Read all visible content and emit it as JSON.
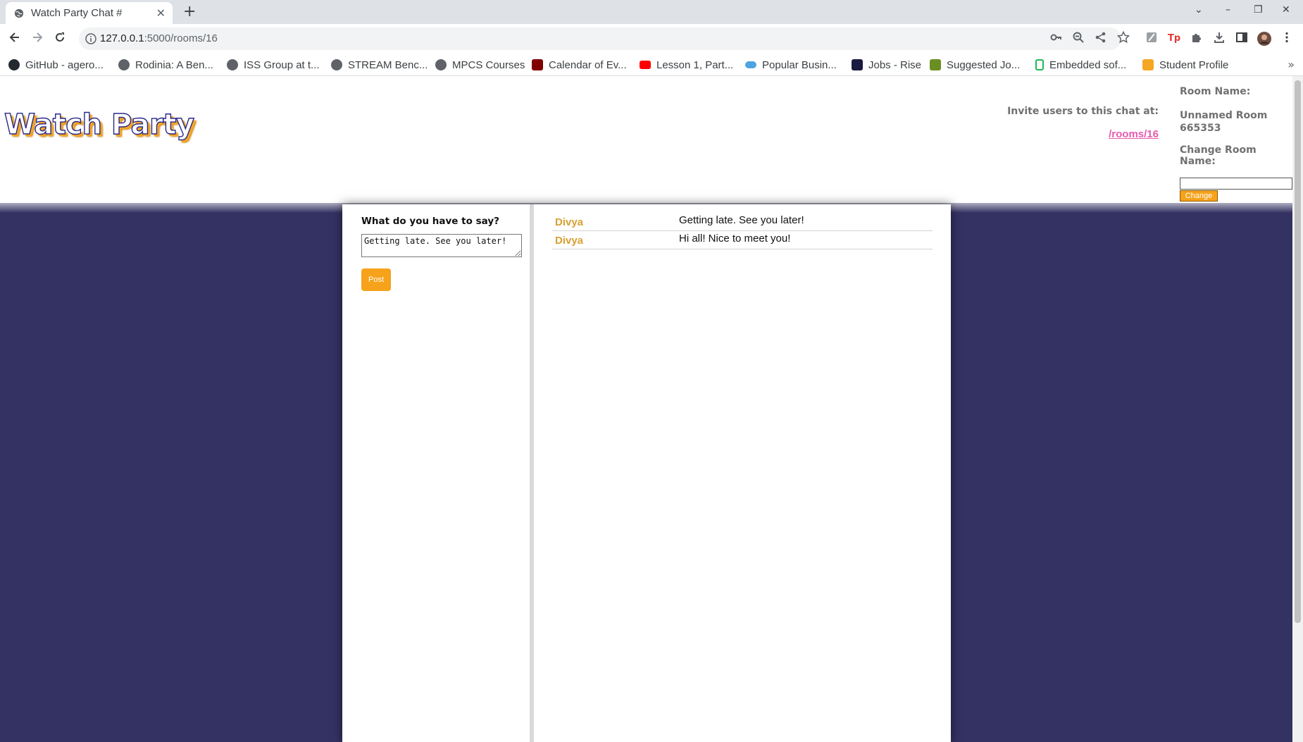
{
  "browser": {
    "tab_title": "Watch Party Chat #",
    "tab_close": "✕",
    "new_tab": "+",
    "url_host": "127.0.0.1",
    "url_rest": ":5000/rooms/16",
    "win_min": "–",
    "win_max": "❐",
    "win_close": "✕",
    "tab_list": "⌄"
  },
  "bookmarks": [
    {
      "label": "GitHub - agero...",
      "color": "#24292f"
    },
    {
      "label": "Rodinia: A Ben...",
      "color": "#5f6368"
    },
    {
      "label": "ISS Group at t...",
      "color": "#5f6368"
    },
    {
      "label": "STREAM Benc...",
      "color": "#5f6368"
    },
    {
      "label": "MPCS Courses",
      "color": "#5f6368"
    },
    {
      "label": "Calendar of Ev...",
      "color": "#800000"
    },
    {
      "label": "Lesson 1, Part...",
      "color": "#ff0000"
    },
    {
      "label": "Popular Busin...",
      "color": "#4fa3e0"
    },
    {
      "label": "Jobs - Rise",
      "color": "#1a1a40"
    },
    {
      "label": "Suggested Jo...",
      "color": "#6b8e23"
    },
    {
      "label": "Embedded sof...",
      "color": "#1db954"
    },
    {
      "label": "Student Profile",
      "color": "#f5a623"
    }
  ],
  "bookmarks_more": "»",
  "header": {
    "logo": "Watch Party",
    "invite_label": "Invite users to this chat at:",
    "invite_link": "/rooms/16",
    "room_name_label": "Room Name:",
    "room_name": "Unnamed Room 665353",
    "change_label": "Change Room Name:",
    "change_input_value": "",
    "change_button": "Change"
  },
  "compose": {
    "prompt": "What do you have to say?",
    "text": "Getting late. See you later!",
    "post_button": "Post"
  },
  "messages": [
    {
      "author": "Divya",
      "body": "Getting late. See you later!"
    },
    {
      "author": "Divya",
      "body": "Hi all! Nice to meet you!"
    }
  ],
  "colors": {
    "page_background": "#343262",
    "accent_orange": "#f7a21b",
    "author_color": "#d9a033",
    "link_pink": "#e85aad"
  }
}
